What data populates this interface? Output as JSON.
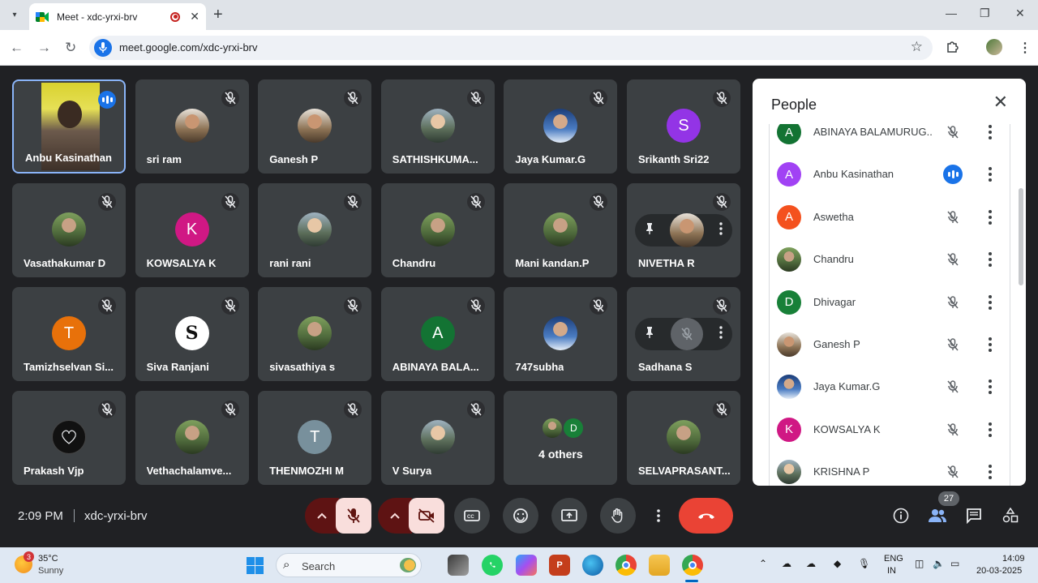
{
  "browser": {
    "tab_title": "Meet - xdc-yrxi-brv",
    "url": "meet.google.com/xdc-yrxi-brv",
    "new_tab": "+",
    "close_tab": "✕",
    "list_tabs": "▾",
    "minimize": "—",
    "maximize": "❐",
    "close_window": "✕"
  },
  "tiles": [
    {
      "name": "Anbu Kasinathan",
      "type": "video",
      "speaking": true
    },
    {
      "name": "sri ram",
      "type": "photo",
      "style": "photo2"
    },
    {
      "name": "Ganesh P",
      "type": "photo",
      "style": "photo2"
    },
    {
      "name": "SATHISHKUMA...",
      "type": "photo",
      "style": "photo"
    },
    {
      "name": "Jaya Kumar.G",
      "type": "photo",
      "style": "photo3"
    },
    {
      "name": "Srikanth Sri22",
      "type": "letter",
      "letter": "S",
      "color": "#9334e6"
    },
    {
      "name": "Vasathakumar D",
      "type": "photo",
      "style": "photo4"
    },
    {
      "name": "KOWSALYA K",
      "type": "letter",
      "letter": "K",
      "color": "#d01884"
    },
    {
      "name": "rani rani",
      "type": "photo",
      "style": "photo"
    },
    {
      "name": "Chandru",
      "type": "photo",
      "style": "photo4"
    },
    {
      "name": "Mani kandan.P",
      "type": "photo",
      "style": "photo4"
    },
    {
      "name": "NIVETHA R",
      "type": "hover-photo"
    },
    {
      "name": "Tamizhselvan Si...",
      "type": "letter",
      "letter": "T",
      "color": "#e8710a"
    },
    {
      "name": "Siva Ranjani",
      "type": "logo"
    },
    {
      "name": "sivasathiya s",
      "type": "photo",
      "style": "photo4"
    },
    {
      "name": "ABINAYA BALA...",
      "type": "letter",
      "letter": "A",
      "color": "#137333"
    },
    {
      "name": "747subha",
      "type": "photo",
      "style": "photo3"
    },
    {
      "name": "Sadhana S",
      "type": "hover-mute"
    },
    {
      "name": "Prakash Vjp",
      "type": "dark"
    },
    {
      "name": "Vethachalamve...",
      "type": "photo",
      "style": "photo4"
    },
    {
      "name": "THENMOZHI M",
      "type": "letter",
      "letter": "T",
      "color": "#78909c"
    },
    {
      "name": "V Surya",
      "type": "photo",
      "style": "photo"
    },
    {
      "name": "4 others",
      "type": "others",
      "letter": "D"
    },
    {
      "name": "SELVAPRASANT...",
      "type": "photo",
      "style": "photo4"
    }
  ],
  "people_panel": {
    "title": "People",
    "close": "✕",
    "participants": [
      {
        "name": "ABINAYA BALAMURUG...",
        "letter": "A",
        "color": "#137333",
        "speaking": false
      },
      {
        "name": "Anbu Kasinathan",
        "letter": "A",
        "color": "#a142f4",
        "speaking": true
      },
      {
        "name": "Aswetha",
        "letter": "A",
        "color": "#f4511e",
        "speaking": false
      },
      {
        "name": "Chandru",
        "letter": "",
        "color": "photo4",
        "speaking": false
      },
      {
        "name": "Dhivagar",
        "letter": "D",
        "color": "#188038",
        "speaking": false
      },
      {
        "name": "Ganesh P",
        "letter": "",
        "color": "photo2",
        "speaking": false
      },
      {
        "name": "Jaya Kumar.G",
        "letter": "",
        "color": "photo3",
        "speaking": false
      },
      {
        "name": "KOWSALYA K",
        "letter": "K",
        "color": "#d01884",
        "speaking": false
      },
      {
        "name": "KRISHNA P",
        "letter": "",
        "color": "photo",
        "speaking": false
      }
    ]
  },
  "controls": {
    "time": "2:09 PM",
    "meeting_code": "xdc-yrxi-brv",
    "people_count": "27"
  },
  "taskbar": {
    "weather_badge": "3",
    "temperature": "35°C",
    "condition": "Sunny",
    "search_placeholder": "Search",
    "lang_line1": "ENG",
    "lang_line2": "IN",
    "time": "14:09",
    "date": "20-03-2025"
  }
}
